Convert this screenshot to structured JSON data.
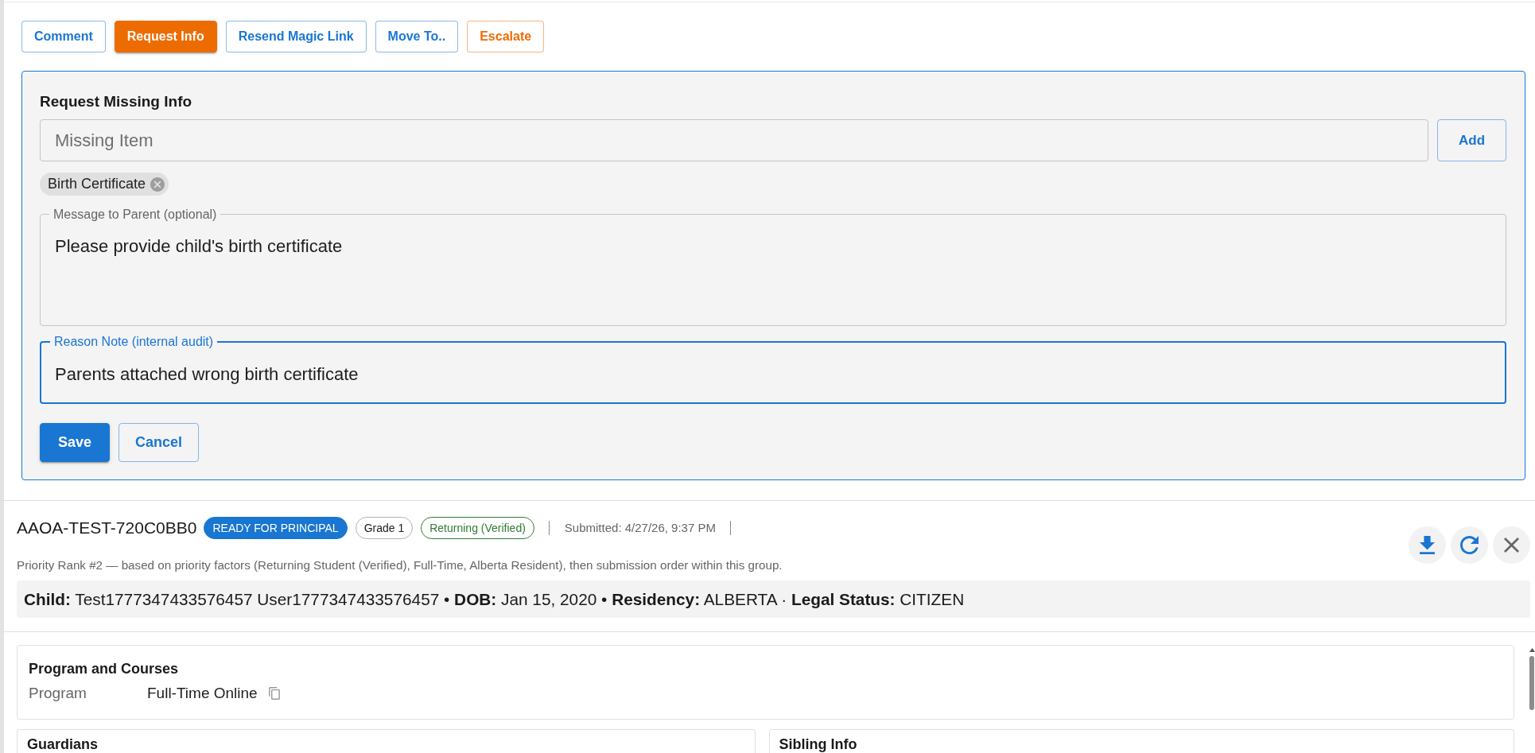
{
  "actions": [
    {
      "label": "Comment",
      "kind": "primary",
      "selected": false
    },
    {
      "label": "Request Info",
      "kind": "warning",
      "selected": true
    },
    {
      "label": "Resend Magic Link",
      "kind": "primary",
      "selected": false
    },
    {
      "label": "Move To..",
      "kind": "primary",
      "selected": false
    },
    {
      "label": "Escalate",
      "kind": "warning",
      "selected": false
    }
  ],
  "request_panel": {
    "title": "Request Missing Info",
    "missing_item": {
      "placeholder": "Missing Item"
    },
    "add_button": "Add",
    "items": [
      {
        "label": "Birth Certificate"
      }
    ],
    "message": {
      "label": "Message to Parent (optional)",
      "value": "Please provide child's birth certificate",
      "focused": false
    },
    "reason_note": {
      "label": "Reason Note (internal audit)",
      "value": "Parents attached wrong birth certificate",
      "focused": true
    },
    "buttons": [
      {
        "label": "Save",
        "kind": "filled"
      },
      {
        "label": "Cancel",
        "kind": "outline"
      }
    ]
  },
  "record": {
    "id": "AAOA-TEST-720C0BB0",
    "badges": [
      {
        "label": "READY FOR PRINCIPAL",
        "kind": "filled",
        "color": "#1976d2"
      },
      {
        "label": "Grade 1",
        "kind": "plain",
        "color": "#b3b3b3"
      },
      {
        "label": "Returning (Verified)",
        "kind": "outline",
        "color": "#2e7d32"
      }
    ],
    "submitted": "Submitted: 4/27/26, 9:37 PM",
    "priority_note": "Priority Rank #2 — based on priority factors (Returning Student (Verified), Full-Time, Alberta Resident), then submission order within this group.",
    "child_summary": "**Child:** Test1777347433576457 User1777347433576457 • **DOB:** Jan 15, 2020 • **Residency:** ALBERTA · **Legal Status:** CITIZEN"
  },
  "program_section": {
    "title": "Program and Courses",
    "fields": [
      {
        "label": "Program",
        "value": "Full-Time Online",
        "copyable": true
      }
    ]
  },
  "columns": [
    {
      "title": "Guardians"
    },
    {
      "title": "Sibling Info"
    }
  ]
}
